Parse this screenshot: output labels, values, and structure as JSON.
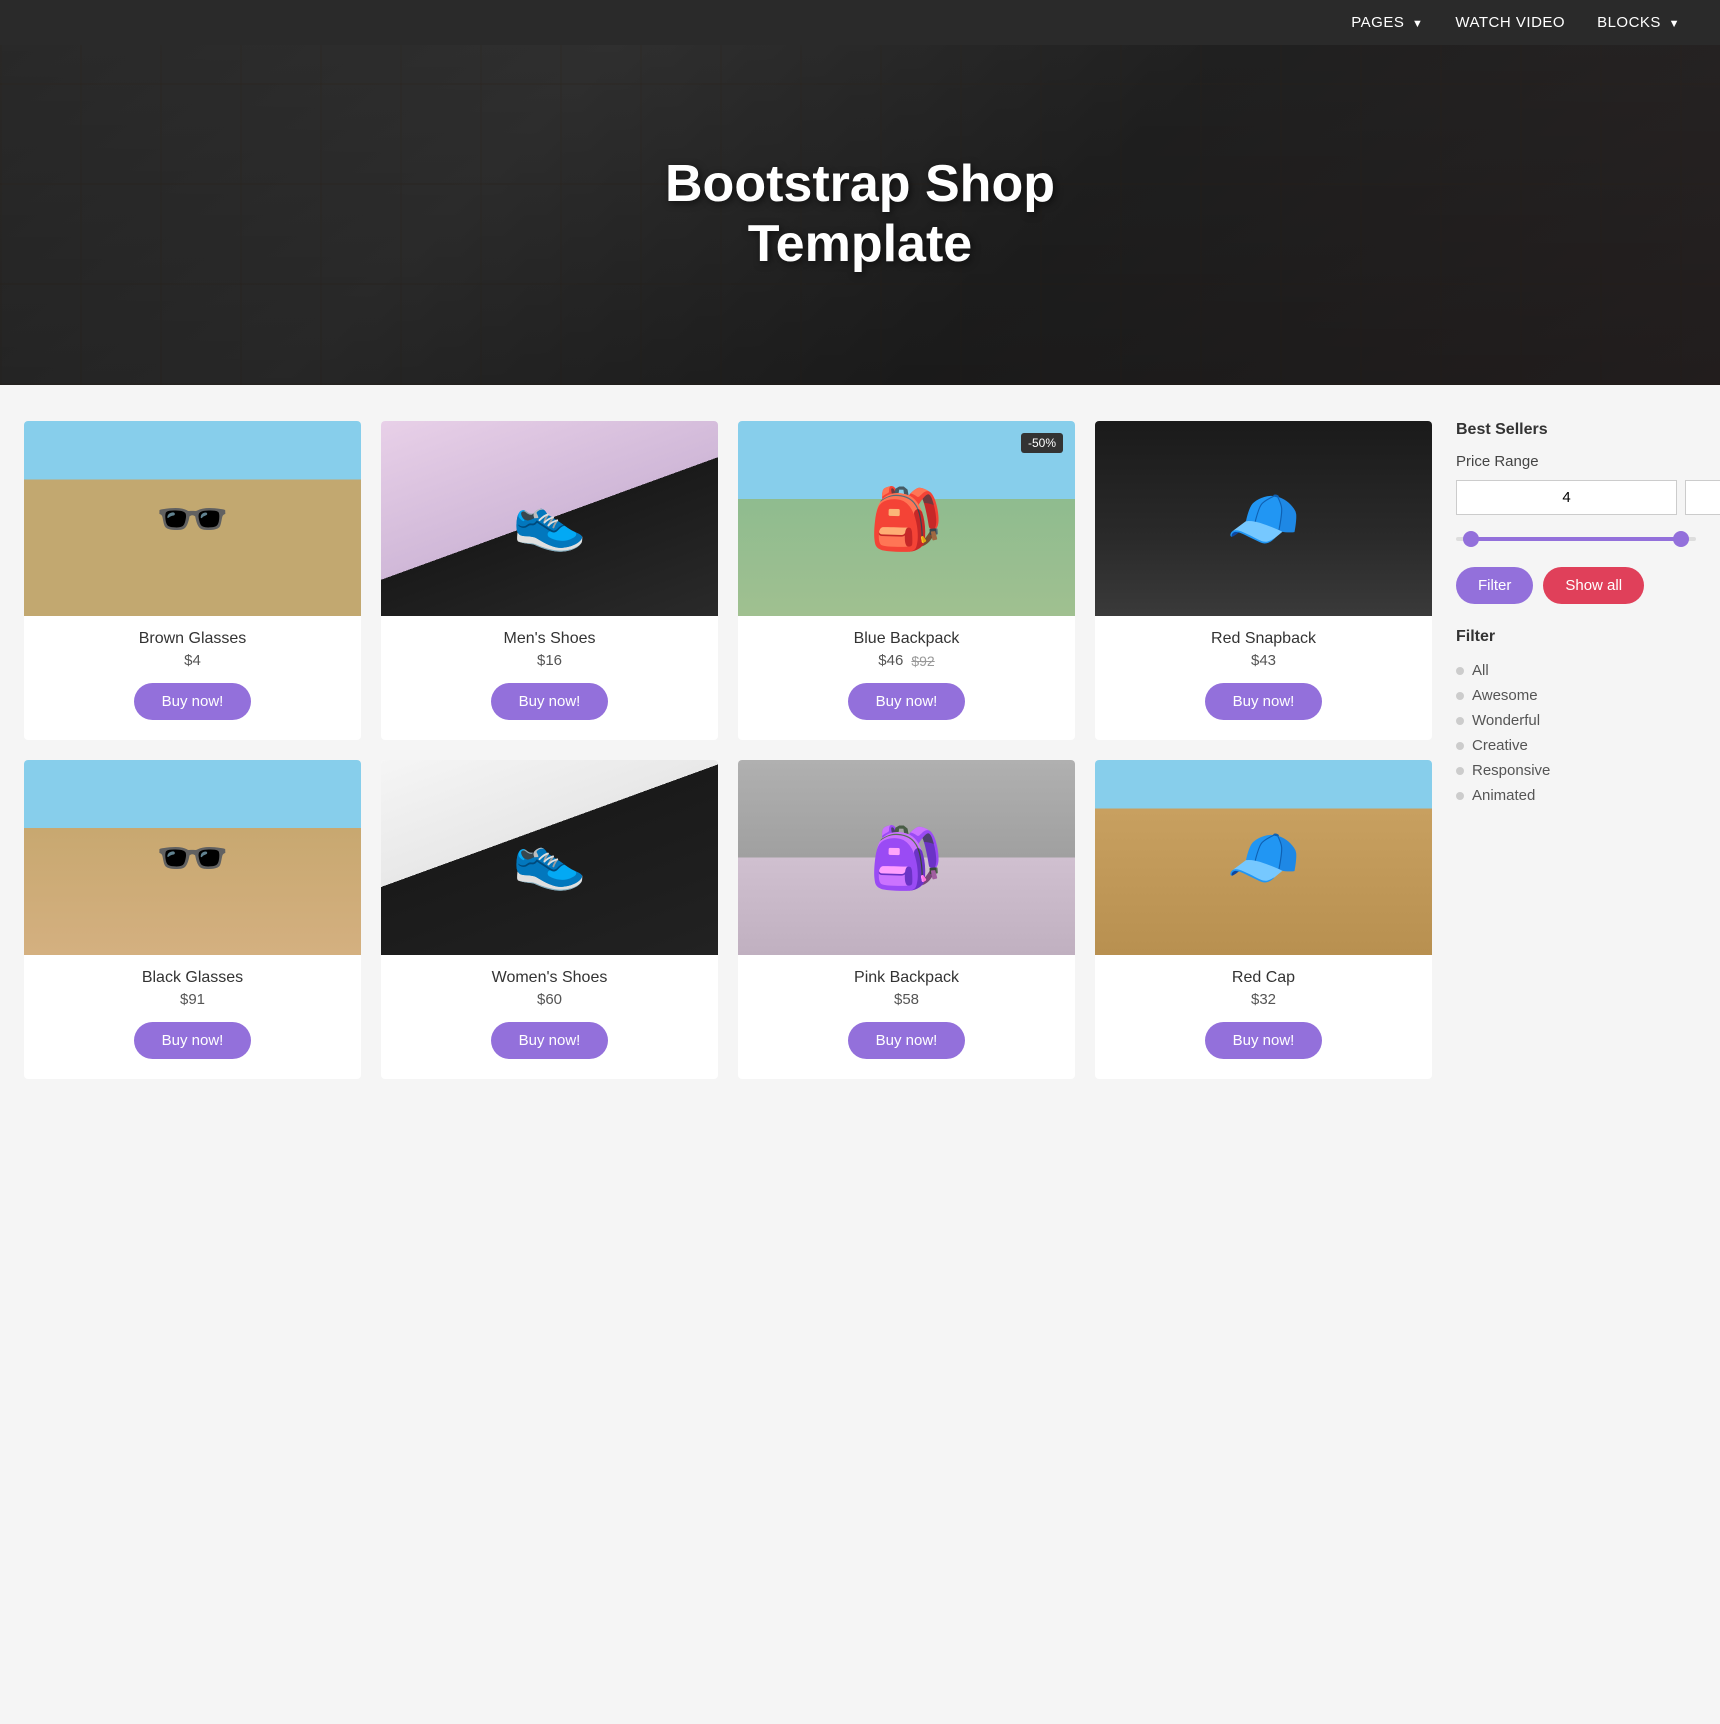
{
  "navbar": {
    "items": [
      {
        "label": "PAGES",
        "hasArrow": true
      },
      {
        "label": "WATCH VIDEO",
        "hasArrow": false
      },
      {
        "label": "BLOCKS",
        "hasArrow": true
      }
    ]
  },
  "hero": {
    "title_line1": "Bootstrap Shop",
    "title_line2": "Template"
  },
  "products": [
    {
      "id": "brown-glasses",
      "name": "Brown Glasses",
      "price": "$4",
      "original_price": null,
      "badge": null,
      "img_class": "img-brown-glasses",
      "buy_label": "Buy now!"
    },
    {
      "id": "mens-shoes",
      "name": "Men's Shoes",
      "price": "$16",
      "original_price": null,
      "badge": null,
      "img_class": "img-mens-shoes",
      "buy_label": "Buy now!"
    },
    {
      "id": "blue-backpack",
      "name": "Blue Backpack",
      "price": "$46",
      "original_price": "$92",
      "badge": "-50%",
      "img_class": "img-blue-backpack",
      "buy_label": "Buy now!"
    },
    {
      "id": "red-snapback",
      "name": "Red Snapback",
      "price": "$43",
      "original_price": null,
      "badge": null,
      "img_class": "img-red-snapback",
      "buy_label": "Buy now!"
    },
    {
      "id": "black-glasses",
      "name": "Black Glasses",
      "price": "$91",
      "original_price": null,
      "badge": null,
      "img_class": "img-black-glasses",
      "buy_label": "Buy now!"
    },
    {
      "id": "womens-shoes",
      "name": "Women's Shoes",
      "price": "$60",
      "original_price": null,
      "badge": null,
      "img_class": "img-womens-shoes",
      "buy_label": "Buy now!"
    },
    {
      "id": "pink-backpack",
      "name": "Pink Backpack",
      "price": "$58",
      "original_price": null,
      "badge": null,
      "img_class": "img-pink-backpack",
      "buy_label": "Buy now!"
    },
    {
      "id": "red-cap",
      "name": "Red Cap",
      "price": "$32",
      "original_price": null,
      "badge": null,
      "img_class": "img-red-cap",
      "buy_label": "Buy now!"
    }
  ],
  "sidebar": {
    "best_sellers_label": "Best Sellers",
    "price_range_label": "Price Range",
    "price_min": "4",
    "price_max": "91",
    "filter_btn_label": "Filter",
    "show_all_btn_label": "Show all",
    "filter_section_label": "Filter",
    "filter_items": [
      {
        "label": "All"
      },
      {
        "label": "Awesome"
      },
      {
        "label": "Wonderful"
      },
      {
        "label": "Creative"
      },
      {
        "label": "Responsive"
      },
      {
        "label": "Animated"
      }
    ]
  }
}
